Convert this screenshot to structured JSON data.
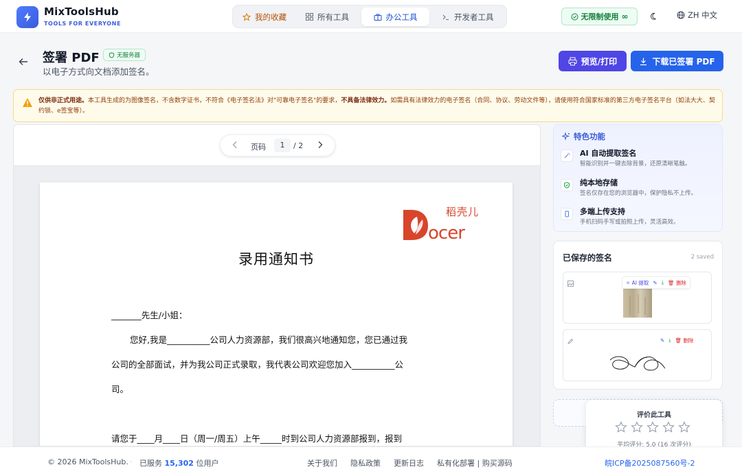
{
  "header": {
    "brand_name": "MixToolsHub",
    "brand_tagline": "TOOLS FOR EVERYONE",
    "tabs": [
      {
        "label": "我的收藏"
      },
      {
        "label": "所有工具"
      },
      {
        "label": "办公工具"
      },
      {
        "label": "开发者工具"
      }
    ],
    "unlimited_label": "无限制使用",
    "language_label": "ZH 中文"
  },
  "page": {
    "title": "签署 PDF",
    "badge": "无服务器",
    "subtitle": "以电子方式向文档添加签名。",
    "print_button": "预览/打印",
    "download_button": "下载已签署 PDF"
  },
  "warning": {
    "lead": "仅供非正式用途。",
    "body1": "本工具生成的为图像签名，不含数字证书，不符合《电子签名法》对\"可靠电子签名\"的要求，",
    "strong": "不具备法律效力。",
    "body2": "如需具有法律效力的电子签名（合同、协议、劳动文件等），请使用符合国家标准的第三方电子签名平台（如法大大、契约锁、e签宝等）。"
  },
  "pager": {
    "label": "页码",
    "current": "1",
    "total": "/ 2"
  },
  "document": {
    "logo_text": "稻壳儿",
    "title": "录用通知书",
    "lines": [
      "_______先生/小姐：",
      "您好,我是__________公司人力资源部，我们很高兴地通知您，您已通过我",
      "公司的全部面试，并为我公司正式录取，我代表公司欢迎您加入__________公",
      "司。",
      "请您于____月____日（周一/周五）上午_____时到公司人力资源部报到，报到"
    ]
  },
  "features": {
    "title": "特色功能",
    "items": [
      {
        "title": "AI 自动提取签名",
        "desc": "智能识别并一键去除背景，还原清晰笔触。"
      },
      {
        "title": "纯本地存储",
        "desc": "签名仅存在您的浏览器中，保护隐私不上传。"
      },
      {
        "title": "多端上传支持",
        "desc": "手机扫码手写或拍照上传，灵活高效。"
      }
    ]
  },
  "saved": {
    "title": "已保存的签名",
    "count": "2 saved",
    "ai_extract": "AI 提取",
    "delete_label": "删除"
  },
  "rating": {
    "title": "评价此工具",
    "average": "平均评分: 5.0 (16 次评分)"
  },
  "footer": {
    "copyright": "© 2026 MixToolsHub.",
    "served_prefix": "已服务",
    "served_count": "15,302",
    "served_suffix": "位用户",
    "links": [
      "关于我们",
      "隐私政策",
      "更新日志",
      "私有化部署 | 购买源码"
    ],
    "icp": "皖ICP备2025087560号-2"
  },
  "colors": {
    "primary": "#2563eb",
    "indigo": "#4f46e5",
    "success": "#15803d",
    "warning_bg": "#fffbea",
    "danger": "#dc2626"
  }
}
